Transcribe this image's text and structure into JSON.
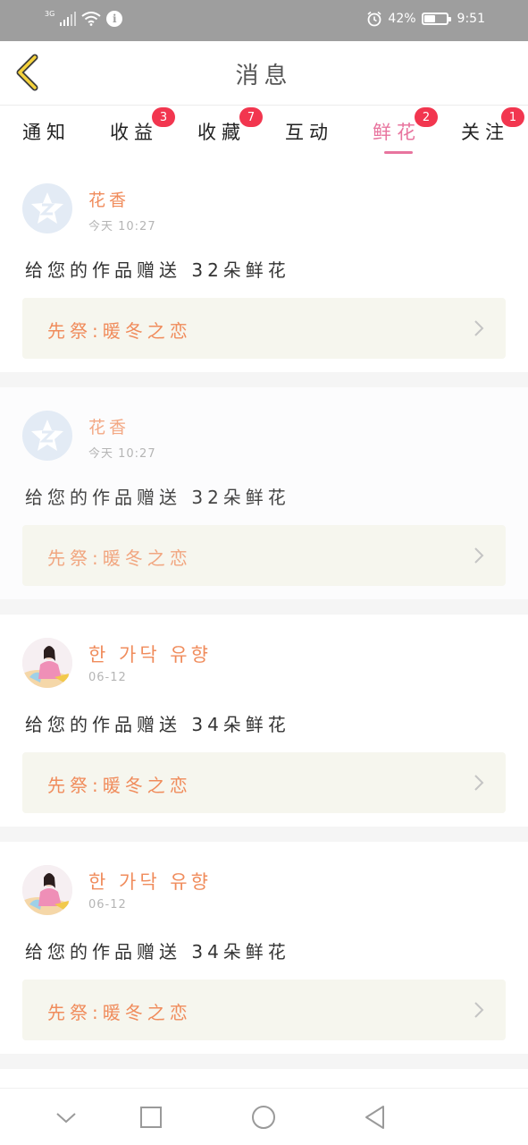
{
  "status_bar": {
    "signal_label": "3G",
    "battery_percent": "42%",
    "time": "9:51",
    "icons": [
      "signal-icon",
      "wifi-icon",
      "info-icon",
      "alarm-icon",
      "battery-icon"
    ]
  },
  "header": {
    "title": "消息",
    "back_icon": "chevron-left-icon"
  },
  "tabs": [
    {
      "label": "通知",
      "badge": ""
    },
    {
      "label": "收益",
      "badge": "3"
    },
    {
      "label": "收藏",
      "badge": "7"
    },
    {
      "label": "互动",
      "badge": ""
    },
    {
      "label": "鲜花",
      "badge": "2",
      "active": true
    },
    {
      "label": "关注",
      "badge": "1"
    }
  ],
  "colors": {
    "accent": "#e8749e",
    "badge": "#f2364f",
    "sender": "#f08c5c",
    "work_box": "#f6f6ee"
  },
  "messages": [
    {
      "sender": "花香",
      "time": "今天  10:27",
      "text": "给您的作品赠送 32朵鲜花",
      "work": "先祭:暖冬之恋",
      "avatar": "default-avatar-icon"
    },
    {
      "sender": "花香",
      "time": "今天  10:27",
      "text": "给您的作品赠送 32朵鲜花",
      "work": "先祭:暖冬之恋",
      "avatar": "default-avatar-icon"
    },
    {
      "sender": "한 가닥 유향",
      "time": "06-12",
      "text": "给您的作品赠送 34朵鲜花",
      "work": "先祭:暖冬之恋",
      "avatar": "user-photo"
    },
    {
      "sender": "한 가닥 유향",
      "time": "06-12",
      "text": "给您的作品赠送 34朵鲜花",
      "work": "先祭:暖冬之恋",
      "avatar": "user-photo"
    }
  ],
  "nav_bar": {
    "icons": [
      "collapse-icon",
      "recents-icon",
      "home-icon",
      "back-icon"
    ]
  }
}
